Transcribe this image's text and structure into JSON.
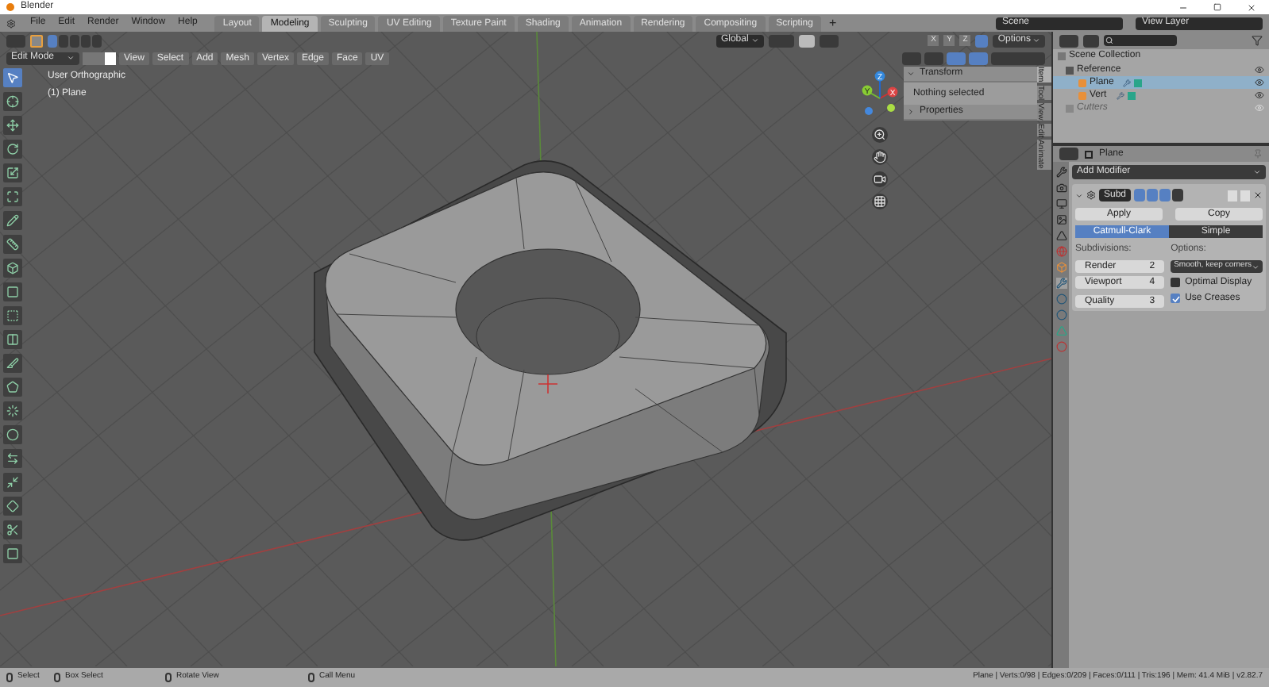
{
  "window": {
    "title": "Blender"
  },
  "menus": [
    "File",
    "Edit",
    "Render",
    "Window",
    "Help"
  ],
  "workspaces": [
    {
      "label": "Layout",
      "selected": false
    },
    {
      "label": "Modeling",
      "selected": true
    },
    {
      "label": "Sculpting",
      "selected": false
    },
    {
      "label": "UV Editing",
      "selected": false
    },
    {
      "label": "Texture Paint",
      "selected": false
    },
    {
      "label": "Shading",
      "selected": false
    },
    {
      "label": "Animation",
      "selected": false
    },
    {
      "label": "Rendering",
      "selected": false
    },
    {
      "label": "Compositing",
      "selected": false
    },
    {
      "label": "Scripting",
      "selected": false
    }
  ],
  "add_workspace": "+",
  "scene": "Scene",
  "view_layer": "View Layer",
  "tool_header": {
    "select_modes": [
      {
        "on": true
      },
      {
        "on": false
      },
      {
        "on": false
      },
      {
        "on": false
      },
      {
        "on": false
      }
    ],
    "orientation": "Global",
    "axes": [
      "X",
      "Y",
      "Z"
    ],
    "xray": {
      "on": true
    },
    "options": "Options"
  },
  "edit_header": {
    "mode": "Edit Mode",
    "element_modes": [
      {
        "selected": false
      },
      {
        "selected": false
      },
      {
        "selected": true
      }
    ],
    "menus": [
      "View",
      "Select",
      "Add",
      "Mesh",
      "Vertex",
      "Edge",
      "Face",
      "UV"
    ],
    "toggles": [
      {
        "on": false
      },
      {
        "on": false
      },
      {
        "on": true
      },
      {
        "on": true
      },
      {
        "on": false
      }
    ]
  },
  "viewport": {
    "view_name": "User Orthographic",
    "object": "(1) Plane",
    "gizmo": [
      "X",
      "Y",
      "Z"
    ]
  },
  "tools": [
    {
      "kind": "select",
      "selected": true
    },
    {
      "kind": "cursor",
      "selected": false
    },
    {
      "kind": "move",
      "selected": false
    },
    {
      "kind": "rotate",
      "selected": false
    },
    {
      "kind": "scale",
      "selected": false
    },
    {
      "kind": "transform",
      "selected": false
    },
    {
      "kind": "annotate",
      "selected": false
    },
    {
      "kind": "measure",
      "selected": false
    },
    {
      "kind": "extrude",
      "selected": false
    },
    {
      "kind": "inset",
      "selected": false
    },
    {
      "kind": "bevel",
      "selected": false
    },
    {
      "kind": "loopcut",
      "selected": false
    },
    {
      "kind": "knife",
      "selected": false
    },
    {
      "kind": "polybuild",
      "selected": false
    },
    {
      "kind": "spin",
      "selected": false
    },
    {
      "kind": "smooth",
      "selected": false
    },
    {
      "kind": "slide",
      "selected": false
    },
    {
      "kind": "shrink",
      "selected": false
    },
    {
      "kind": "shear",
      "selected": false
    },
    {
      "kind": "rip",
      "selected": false
    },
    {
      "kind": "box",
      "selected": false
    }
  ],
  "sidebar": {
    "tabs": [
      {
        "label": "Item",
        "selected": true
      },
      {
        "label": "Tool",
        "selected": false
      },
      {
        "label": "View",
        "selected": false
      },
      {
        "label": "Edit",
        "selected": false
      },
      {
        "label": "Animate",
        "selected": false
      }
    ],
    "panels": [
      {
        "title": "Transform",
        "expanded": true,
        "body": "Nothing selected"
      },
      {
        "title": "Properties",
        "expanded": false
      }
    ]
  },
  "outliner": {
    "root": "Scene Collection",
    "items": [
      {
        "label": "Reference",
        "disabled": false,
        "selected": false,
        "children": [
          {
            "label": "Plane",
            "selected": true
          },
          {
            "label": "Vert",
            "selected": false
          }
        ]
      },
      {
        "label": "Cutters",
        "disabled": true,
        "selected": false
      }
    ]
  },
  "properties": {
    "object": "Plane",
    "add_modifier": "Add Modifier",
    "modifier": {
      "name": "Subd",
      "display_toggles": [
        {
          "on": true
        },
        {
          "on": true
        },
        {
          "on": true
        },
        {
          "on": false
        }
      ],
      "apply": "Apply",
      "copy": "Copy",
      "types": [
        {
          "label": "Catmull-Clark",
          "selected": true
        },
        {
          "label": "Simple",
          "selected": false
        }
      ],
      "subdivisions_label": "Subdivisions:",
      "fields": [
        {
          "label": "Render",
          "value": "2"
        },
        {
          "label": "Viewport",
          "value": "4"
        },
        {
          "label": "Quality",
          "value": "3"
        }
      ],
      "options_label": "Options:",
      "uv_smooth": "Smooth, keep corners",
      "checkboxes": [
        {
          "label": "Optimal Display",
          "checked": false
        },
        {
          "label": "Use Creases",
          "checked": true
        }
      ]
    }
  },
  "status_bar": {
    "hints": [
      "Select",
      "Box Select",
      "Rotate View",
      "Call Menu"
    ],
    "stats": "Plane | Verts:0/98 | Edges:0/209 | Faces:0/111 | Tris:196 | Mem: 41.4 MiB | v2.82.7"
  }
}
